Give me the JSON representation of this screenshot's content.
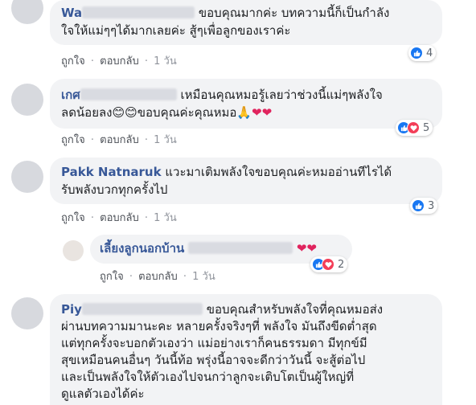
{
  "comments": [
    {
      "author_visible": "Wa",
      "lines": [
        "ขอบคุณมากค่ะ บทความนี้ก็เป็นกำลัง",
        "ใจให้แม่ๆๆได้มากเลยค่ะ สู้ๆเพื่อลูกของเราค่ะ"
      ],
      "like_label": "ถูกใจ",
      "reply_label": "ตอบกลับ",
      "time": "1 วัน",
      "reaction_count": "4"
    },
    {
      "author_visible": "เกศ",
      "line1_rest": "เหมือนคุณหมอรู้เลยว่าช่วงนี้แม่ๆพลังใจ",
      "line2_start": "ลดน้อยลง",
      "line2_emojis": "😊😊",
      "line2_text": "ขอบคุณค่ะคุณหมอ",
      "line2_end_emojis": "🙏",
      "hearts": "❤❤",
      "like_label": "ถูกใจ",
      "reply_label": "ตอบกลับ",
      "time": "1 วัน",
      "reaction_count": "5"
    },
    {
      "author_visible": "Pakk Natnaruk",
      "line1_rest": "แวะมาเติมพลังใจขอบคุณค่ะหมออ่านทีไรได้",
      "line2": "รับพลังบวกทุกครั้งไป",
      "like_label": "ถูกใจ",
      "reply_label": "ตอบกลับ",
      "time": "1 วัน",
      "reaction_count": "3"
    },
    {
      "author_visible": "เลี้ยงลูกนอกบ้าน",
      "hearts": "❤❤",
      "like_label": "ถูกใจ",
      "reply_label": "ตอบกลับ",
      "time": "1 วัน",
      "reaction_count": "2"
    },
    {
      "author_visible": "Piy",
      "line1_rest": "ขอบคุณสำหรับพลังใจที่คุณหมอส่ง",
      "lines": [
        "ผ่านบทความมานะคะ หลายครั้งจริงๆที่ พลังใจ มันถึงขีดต่ำสุด",
        "แต่ทุกครั้งจะบอกตัวเองว่า แม่อย่างเราก็คนธรรมดา มีทุกข์มี",
        "สุขเหมือนคนอื่นๆ วันนี้ท้อ พรุ่งนี้อาจจะดีกว่าวันนี้ จะสู้ต่อไป",
        "และเป็นพลังใจให้ตัวเองไปจนกว่าลูกจะเติบโตเป็นผู้ใหญ่ที่",
        "ดูแลตัวเองได้ค่ะ"
      ]
    }
  ],
  "separator": "·",
  "colors": {
    "like": "#1877f2",
    "love": "#f33e58",
    "bubble": "#f2f3f5",
    "author": "#385898"
  }
}
